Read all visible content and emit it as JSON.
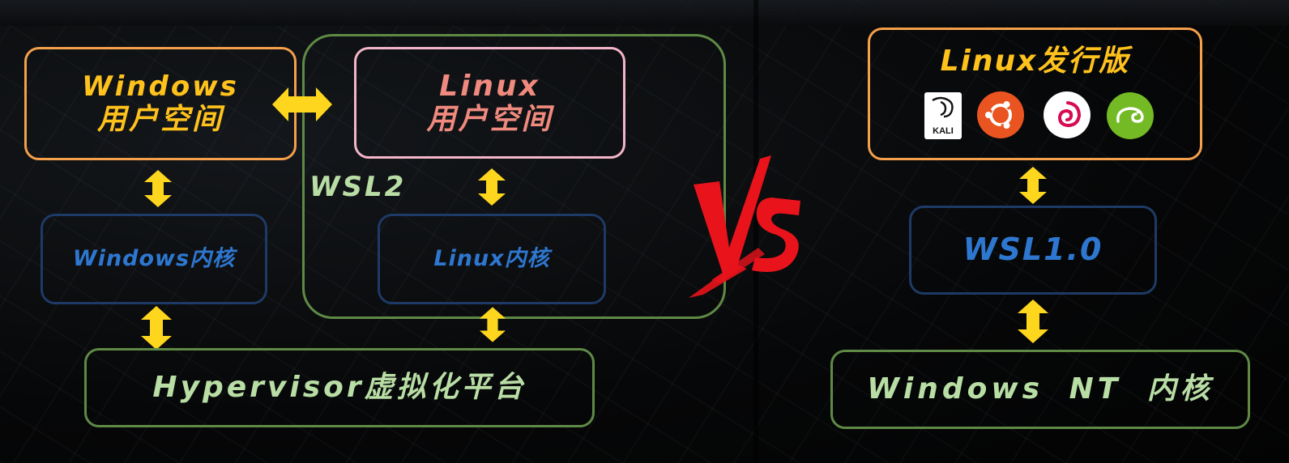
{
  "left": {
    "windows_user": {
      "line1": "Windows",
      "line2": "用户空间"
    },
    "linux_user": {
      "line1": "Linux",
      "line2": "用户空间"
    },
    "wsl2_label": "WSL2",
    "windows_kernel": "Windows内核",
    "linux_kernel": "Linux内核",
    "hypervisor": "Hypervisor虚拟化平台"
  },
  "right": {
    "distro_title": "Linux发行版",
    "distros": [
      {
        "name": "kali-logo",
        "text": "KALI"
      },
      {
        "name": "ubuntu-logo"
      },
      {
        "name": "debian-logo"
      },
      {
        "name": "opensuse-logo"
      }
    ],
    "wsl1": "WSL1.0",
    "nt_kernel": "Windows NT 内核"
  },
  "vs": "VS",
  "colors": {
    "orange": "#F5A04A",
    "yellow": "#FFD61E",
    "pink": "#F3B5C8",
    "salmon": "#F08A7E",
    "navy": "#1E3A66",
    "blue": "#2E77D0",
    "green": "#5F8A46",
    "light_green": "#B9DEA5",
    "red": "#E8131B"
  }
}
